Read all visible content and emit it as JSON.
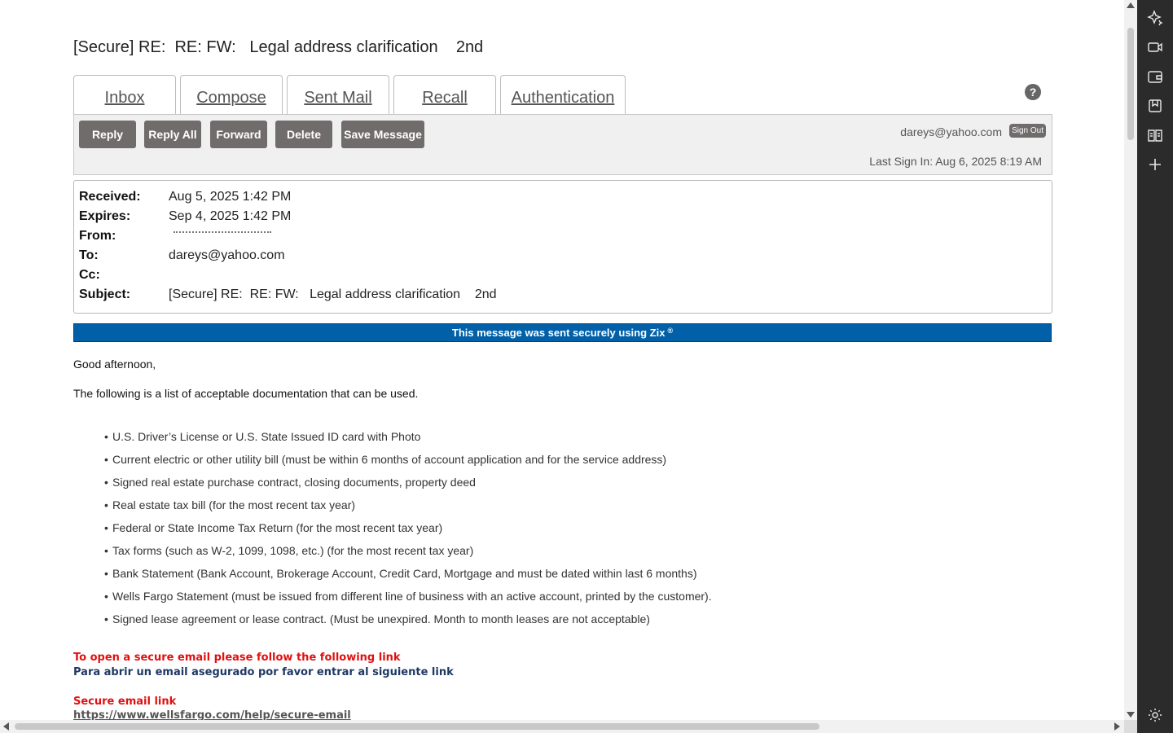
{
  "message": {
    "title": "[Secure] RE:  RE: FW:   Legal address clarification    2nd"
  },
  "tabs": [
    {
      "label": "Inbox"
    },
    {
      "label": "Compose"
    },
    {
      "label": "Sent Mail"
    },
    {
      "label": "Recall"
    },
    {
      "label": "Authentication"
    }
  ],
  "help": {
    "icon": "help-icon",
    "glyph": "?"
  },
  "toolbar": {
    "reply_label": "Reply",
    "reply_all_label": "Reply All",
    "forward_label": "Forward",
    "delete_label": "Delete",
    "save_label": "Save Message",
    "user_email": "dareys@yahoo.com",
    "sign_out_label": "Sign Out",
    "last_sign_in": "Last Sign In: Aug 6, 2025 8:19 AM"
  },
  "headers": {
    "received_label": "Received:",
    "received_value": "Aug 5, 2025 1:42 PM",
    "expires_label": "Expires:",
    "expires_value": "Sep 4, 2025 1:42 PM",
    "from_label": "From:",
    "to_label": "To:",
    "to_value": "dareys@yahoo.com",
    "cc_label": "Cc:",
    "subject_label": "Subject:",
    "subject_value": "[Secure] RE:  RE: FW:   Legal address clarification    2nd"
  },
  "zix_banner": {
    "text": "This message was sent securely using Zix",
    "mark": "®",
    "background": "#0160a8"
  },
  "body": {
    "greeting": "Good afternoon,",
    "intro": "The following is a list of acceptable documentation that can be used.",
    "documents": [
      "U.S. Driver’s License or U.S. State Issued ID card with Photo",
      "Current electric or other utility bill (must be within 6 months of account application and for the service address)",
      "Signed real estate purchase contract, closing documents, property deed",
      "Real estate tax bill (for the most recent tax year)",
      "Federal or State Income Tax Return (for the most recent tax year)",
      "Tax forms (such as W-2, 1099, 1098, etc.) (for the most recent tax year)",
      "Bank Statement (Bank Account, Brokerage Account, Credit Card, Mortgage and must be dated within last 6 months)",
      "Wells Fargo Statement (must be issued from different line of business with an active account, printed by the customer).",
      "Signed lease agreement or lease contract. (Must be unexpired. Month to month leases are not acceptable)"
    ],
    "open_link_en": "To open a secure email please follow the following link",
    "open_link_es": "Para abrir un email asegurado por favor entrar al siguiente link",
    "secure_link_label": "Secure email link",
    "secure_link_url": "https://www.wellsfargo.com/help/secure-email",
    "red_color": "#e01010",
    "navy_color": "#1f3864"
  },
  "side_panel": {
    "icons": [
      "sparkle-icon",
      "video-icon",
      "wallet-icon",
      "bookmark-icon",
      "reader-icon",
      "plus-icon",
      "settings-icon"
    ]
  }
}
